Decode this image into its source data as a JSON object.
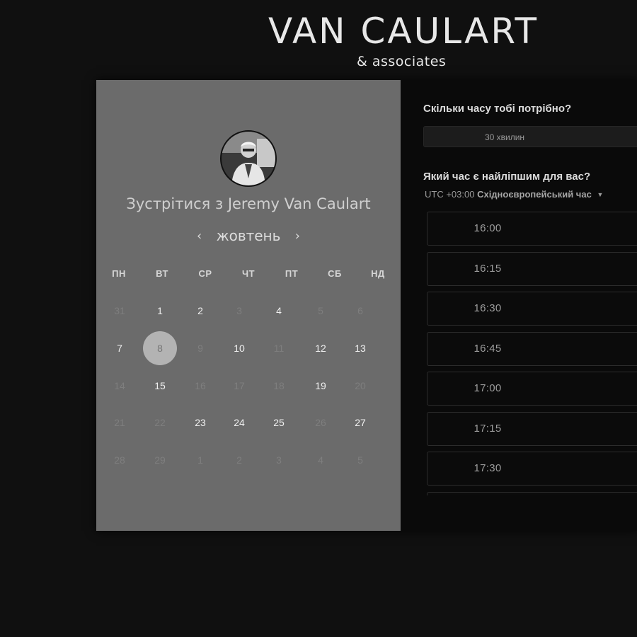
{
  "brand": {
    "title": "VAN CAULART",
    "subtitle": "& associates"
  },
  "calendar": {
    "avatar_icon": "person-photo-icon",
    "meet_prefix": "Зустрітися з ",
    "host_name": "Jeremy Van Caulart",
    "month": "жовтень",
    "prev_arrow": "‹",
    "next_arrow": "›",
    "weekdays": [
      "ПН",
      "ВТ",
      "СР",
      "ЧТ",
      "ПТ",
      "СБ",
      "НД"
    ],
    "weeks": [
      [
        {
          "d": "31",
          "s": "muted"
        },
        {
          "d": "1",
          "s": "avail"
        },
        {
          "d": "2",
          "s": "avail"
        },
        {
          "d": "3",
          "s": "muted"
        },
        {
          "d": "4",
          "s": "avail"
        },
        {
          "d": "5",
          "s": "muted"
        },
        {
          "d": "6",
          "s": "muted"
        }
      ],
      [
        {
          "d": "7",
          "s": "avail"
        },
        {
          "d": "8",
          "s": "selected"
        },
        {
          "d": "9",
          "s": "muted"
        },
        {
          "d": "10",
          "s": "avail"
        },
        {
          "d": "11",
          "s": "muted"
        },
        {
          "d": "12",
          "s": "avail"
        },
        {
          "d": "13",
          "s": "avail"
        }
      ],
      [
        {
          "d": "14",
          "s": "muted"
        },
        {
          "d": "15",
          "s": "avail"
        },
        {
          "d": "16",
          "s": "muted"
        },
        {
          "d": "17",
          "s": "muted"
        },
        {
          "d": "18",
          "s": "muted"
        },
        {
          "d": "19",
          "s": "avail"
        },
        {
          "d": "20",
          "s": "muted"
        }
      ],
      [
        {
          "d": "21",
          "s": "muted"
        },
        {
          "d": "22",
          "s": "muted"
        },
        {
          "d": "23",
          "s": "avail"
        },
        {
          "d": "24",
          "s": "avail"
        },
        {
          "d": "25",
          "s": "avail"
        },
        {
          "d": "26",
          "s": "muted"
        },
        {
          "d": "27",
          "s": "avail"
        }
      ],
      [
        {
          "d": "28",
          "s": "muted"
        },
        {
          "d": "29",
          "s": "muted"
        },
        {
          "d": "1",
          "s": "muted"
        },
        {
          "d": "2",
          "s": "muted"
        },
        {
          "d": "3",
          "s": "muted"
        },
        {
          "d": "4",
          "s": "muted"
        },
        {
          "d": "5",
          "s": "muted"
        }
      ]
    ]
  },
  "booking": {
    "duration_question": "Скільки часу тобі потрібно?",
    "duration_value": "30 хвилин",
    "time_question": "Який час є найліпшим для вас?",
    "timezone_offset": "UTC +03:00",
    "timezone_name": "Східноєвропейський час",
    "timezone_caret": "▼",
    "slots": [
      "16:00",
      "16:15",
      "16:30",
      "16:45",
      "17:00",
      "17:15",
      "17:30",
      ""
    ]
  },
  "colors": {
    "page_bg": "#101010",
    "calendar_bg": "#6b6b6b",
    "panel_bg": "#0a0a0a",
    "selected_day": "#b3b3b3"
  }
}
